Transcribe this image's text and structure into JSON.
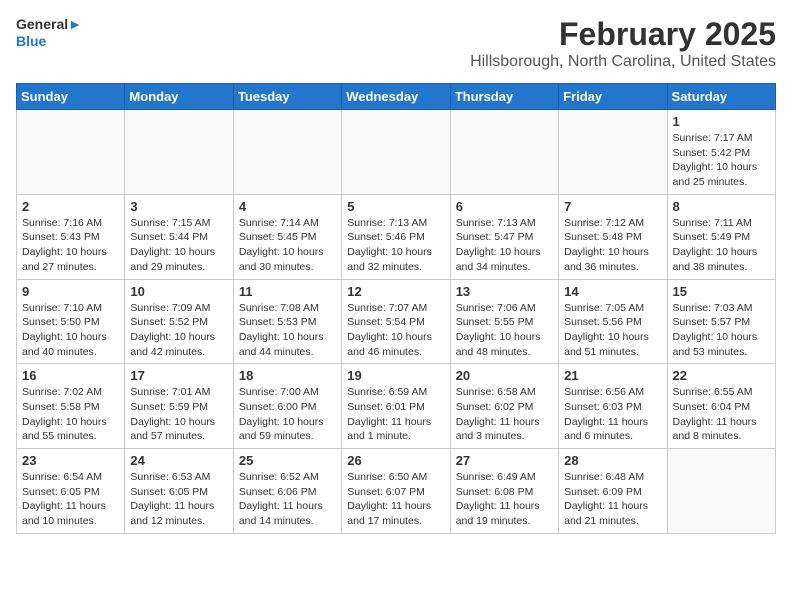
{
  "header": {
    "logo_general": "General",
    "logo_blue": "Blue",
    "month_title": "February 2025",
    "location": "Hillsborough, North Carolina, United States"
  },
  "days_of_week": [
    "Sunday",
    "Monday",
    "Tuesday",
    "Wednesday",
    "Thursday",
    "Friday",
    "Saturday"
  ],
  "weeks": [
    [
      {
        "day": "",
        "info": ""
      },
      {
        "day": "",
        "info": ""
      },
      {
        "day": "",
        "info": ""
      },
      {
        "day": "",
        "info": ""
      },
      {
        "day": "",
        "info": ""
      },
      {
        "day": "",
        "info": ""
      },
      {
        "day": "1",
        "info": "Sunrise: 7:17 AM\nSunset: 5:42 PM\nDaylight: 10 hours and 25 minutes."
      }
    ],
    [
      {
        "day": "2",
        "info": "Sunrise: 7:16 AM\nSunset: 5:43 PM\nDaylight: 10 hours and 27 minutes."
      },
      {
        "day": "3",
        "info": "Sunrise: 7:15 AM\nSunset: 5:44 PM\nDaylight: 10 hours and 29 minutes."
      },
      {
        "day": "4",
        "info": "Sunrise: 7:14 AM\nSunset: 5:45 PM\nDaylight: 10 hours and 30 minutes."
      },
      {
        "day": "5",
        "info": "Sunrise: 7:13 AM\nSunset: 5:46 PM\nDaylight: 10 hours and 32 minutes."
      },
      {
        "day": "6",
        "info": "Sunrise: 7:13 AM\nSunset: 5:47 PM\nDaylight: 10 hours and 34 minutes."
      },
      {
        "day": "7",
        "info": "Sunrise: 7:12 AM\nSunset: 5:48 PM\nDaylight: 10 hours and 36 minutes."
      },
      {
        "day": "8",
        "info": "Sunrise: 7:11 AM\nSunset: 5:49 PM\nDaylight: 10 hours and 38 minutes."
      }
    ],
    [
      {
        "day": "9",
        "info": "Sunrise: 7:10 AM\nSunset: 5:50 PM\nDaylight: 10 hours and 40 minutes."
      },
      {
        "day": "10",
        "info": "Sunrise: 7:09 AM\nSunset: 5:52 PM\nDaylight: 10 hours and 42 minutes."
      },
      {
        "day": "11",
        "info": "Sunrise: 7:08 AM\nSunset: 5:53 PM\nDaylight: 10 hours and 44 minutes."
      },
      {
        "day": "12",
        "info": "Sunrise: 7:07 AM\nSunset: 5:54 PM\nDaylight: 10 hours and 46 minutes."
      },
      {
        "day": "13",
        "info": "Sunrise: 7:06 AM\nSunset: 5:55 PM\nDaylight: 10 hours and 48 minutes."
      },
      {
        "day": "14",
        "info": "Sunrise: 7:05 AM\nSunset: 5:56 PM\nDaylight: 10 hours and 51 minutes."
      },
      {
        "day": "15",
        "info": "Sunrise: 7:03 AM\nSunset: 5:57 PM\nDaylight: 10 hours and 53 minutes."
      }
    ],
    [
      {
        "day": "16",
        "info": "Sunrise: 7:02 AM\nSunset: 5:58 PM\nDaylight: 10 hours and 55 minutes."
      },
      {
        "day": "17",
        "info": "Sunrise: 7:01 AM\nSunset: 5:59 PM\nDaylight: 10 hours and 57 minutes."
      },
      {
        "day": "18",
        "info": "Sunrise: 7:00 AM\nSunset: 6:00 PM\nDaylight: 10 hours and 59 minutes."
      },
      {
        "day": "19",
        "info": "Sunrise: 6:59 AM\nSunset: 6:01 PM\nDaylight: 11 hours and 1 minute."
      },
      {
        "day": "20",
        "info": "Sunrise: 6:58 AM\nSunset: 6:02 PM\nDaylight: 11 hours and 3 minutes."
      },
      {
        "day": "21",
        "info": "Sunrise: 6:56 AM\nSunset: 6:03 PM\nDaylight: 11 hours and 6 minutes."
      },
      {
        "day": "22",
        "info": "Sunrise: 6:55 AM\nSunset: 6:04 PM\nDaylight: 11 hours and 8 minutes."
      }
    ],
    [
      {
        "day": "23",
        "info": "Sunrise: 6:54 AM\nSunset: 6:05 PM\nDaylight: 11 hours and 10 minutes."
      },
      {
        "day": "24",
        "info": "Sunrise: 6:53 AM\nSunset: 6:05 PM\nDaylight: 11 hours and 12 minutes."
      },
      {
        "day": "25",
        "info": "Sunrise: 6:52 AM\nSunset: 6:06 PM\nDaylight: 11 hours and 14 minutes."
      },
      {
        "day": "26",
        "info": "Sunrise: 6:50 AM\nSunset: 6:07 PM\nDaylight: 11 hours and 17 minutes."
      },
      {
        "day": "27",
        "info": "Sunrise: 6:49 AM\nSunset: 6:08 PM\nDaylight: 11 hours and 19 minutes."
      },
      {
        "day": "28",
        "info": "Sunrise: 6:48 AM\nSunset: 6:09 PM\nDaylight: 11 hours and 21 minutes."
      },
      {
        "day": "",
        "info": ""
      }
    ]
  ]
}
